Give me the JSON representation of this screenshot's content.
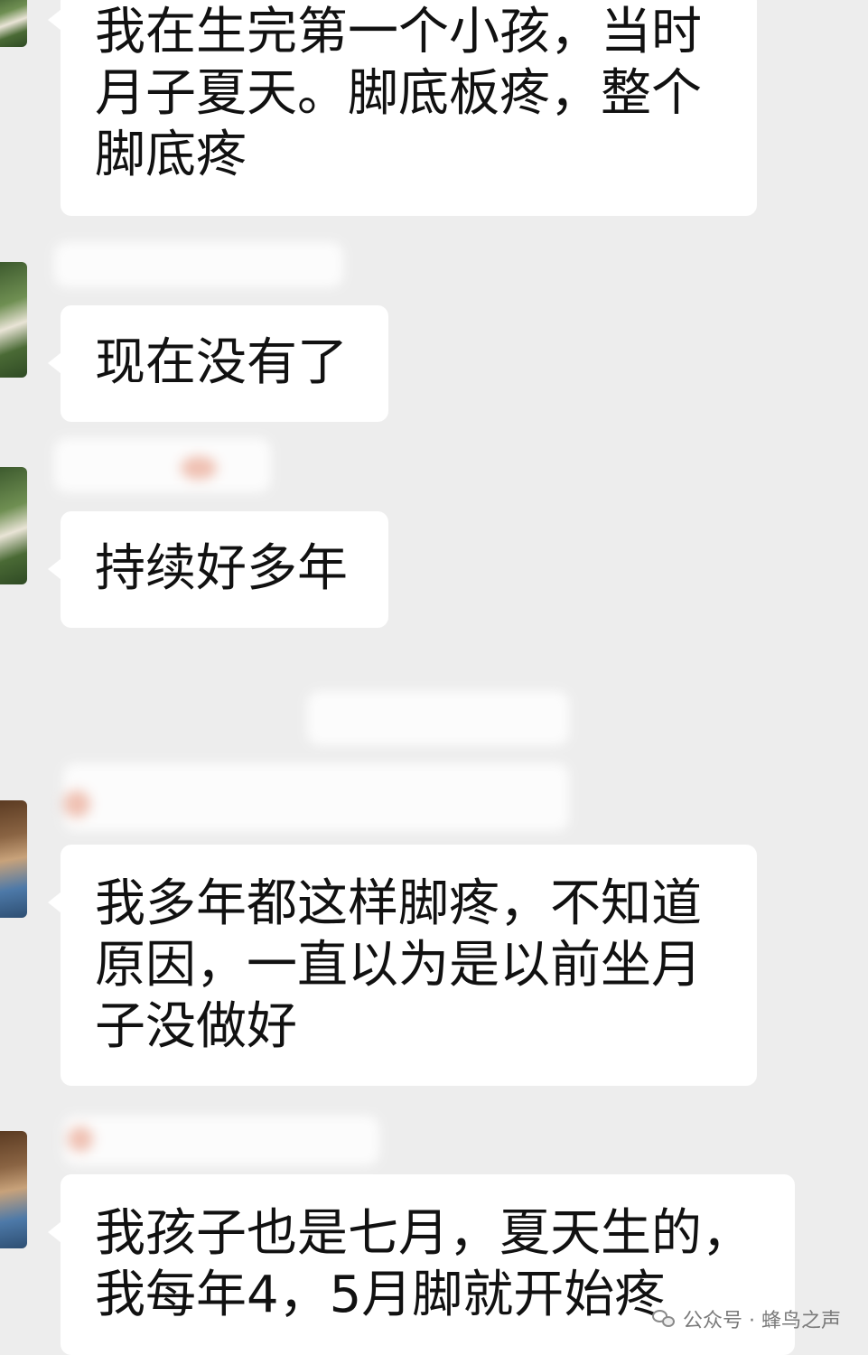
{
  "messages": [
    {
      "text": "我在生完第一个小孩，当时\n月子夏天。脚底板疼，整个\n脚底疼"
    },
    {
      "text": "现在没有了"
    },
    {
      "text": "持续好多年"
    },
    {
      "text": "我多年都这样脚疼，不知道\n原因，一直以为是以前坐月\n子没做好"
    },
    {
      "text": "我孩子也是七月，夏天生的，\n我每年4，5月脚就开始疼"
    }
  ],
  "watermark": {
    "text": "公众号 · 蜂鸟之声",
    "icon": "wechat-icon"
  },
  "colors": {
    "background": "#ededed",
    "bubble": "#ffffff",
    "text": "#111111"
  }
}
